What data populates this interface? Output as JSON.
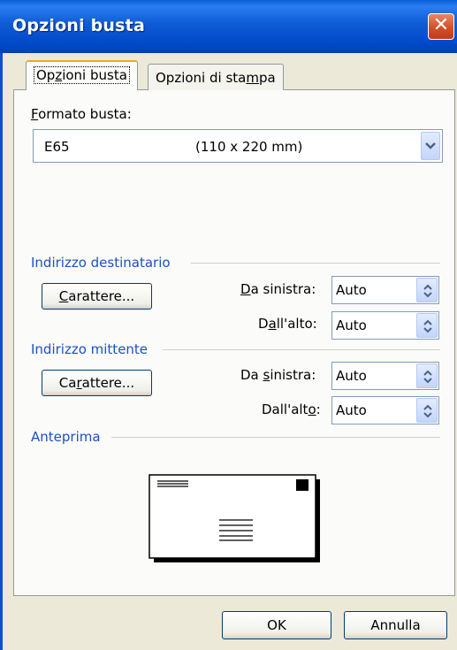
{
  "window": {
    "title": "Opzioni busta",
    "close_label": "✕"
  },
  "tabs": [
    {
      "pre": "Op",
      "u": "z",
      "post": "ioni busta"
    },
    {
      "pre": "Opzioni di sta",
      "u": "m",
      "post": "pa"
    }
  ],
  "format": {
    "label_u": "F",
    "label_rest": "ormato busta:",
    "value_name": "E65",
    "value_size": "(110 x 220 mm)"
  },
  "recipient": {
    "group": "Indirizzo destinatario",
    "font_button": {
      "u": "C",
      "rest": "arattere..."
    },
    "left": {
      "u": "D",
      "rest": "a sinistra:",
      "value": "Auto"
    },
    "top": {
      "pre": "D",
      "u": "a",
      "post": "ll'alto:",
      "value": "Auto"
    }
  },
  "sender": {
    "group": "Indirizzo mittente",
    "font_button": {
      "pre": "Ca",
      "u": "r",
      "post": "attere..."
    },
    "left": {
      "pre": "Da ",
      "u": "s",
      "post": "inistra:",
      "value": "Auto"
    },
    "top": {
      "pre": "Dall'alt",
      "u": "o",
      "post": ":",
      "value": "Auto"
    }
  },
  "preview": {
    "group": "Anteprima"
  },
  "buttons": {
    "ok": "OK",
    "cancel": "Annulla"
  },
  "colors": {
    "title_bar": "#0054e3",
    "group_text": "#1d4fc7",
    "active_tab_accent": "#f5a623"
  },
  "icons": {
    "close": "close-icon",
    "dropdown": "chevron-down-icon",
    "spinner": "up-down-arrows-icon"
  }
}
